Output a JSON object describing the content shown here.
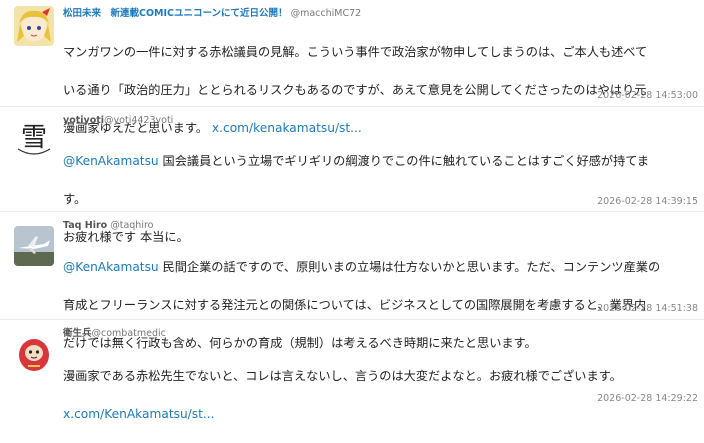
{
  "tweets": [
    {
      "name": "松田未来　新連載COMICユニコーンにて近日公開！",
      "handle": "@macchiMC72",
      "text_line1": "マンガワンの一件に対する赤松議員の見解。こういう事件で政治家が物申してしまうのは、ご本人も述べて",
      "text_line2": "いる通り「政治的圧力」ととられるリスクもあるのですが、あえて意見を公開してくださったのはやはり元",
      "text_line3": "漫画家ゆえだと思います。",
      "link": "x.com/kenakamatsu/st...",
      "timestamp": "2026-02-28 14:53:00"
    },
    {
      "name": "yotiyoti",
      "handle": "@yoti4423yoti",
      "mention": "@KenAkamatsu",
      "text_line1": " 国会議員という立場でギリギリの綱渡りでこの件に触れていることはすごく好感が持てま",
      "text_line2": "す。",
      "text_line3": "お疲れ様です 本当に。",
      "timestamp": "2026-02-28 14:39:15"
    },
    {
      "name": "Taq Hiro",
      "handle": "@taqhiro",
      "mention": "@KenAkamatsu",
      "text_line1": " 民間企業の話ですので、原則いまの立場は仕方ないかと思います。ただ、コンテンツ産業の",
      "text_line2": "育成とフリーランスに対する発注元との関係については、ビジネスとしての国際展開を考慮すると、業界内",
      "text_line3": "だけでは無く行政も含め、何らかの育成（規制）は考えるべき時期に来たと思います。",
      "timestamp": "2026-02-28 14:51:38"
    },
    {
      "name": "衛生兵",
      "handle": "@combatmedic",
      "text_line1": "漫画家である赤松先生でないと、コレは言えないし、言うのは大変だよなと。お疲れ様でございます。",
      "link": "x.com/KenAkamatsu/st...",
      "timestamp": "2026-02-28 14:29:22"
    }
  ],
  "colors": {
    "link": "#1c7bbf",
    "divider": "#e6ecf0",
    "name_highlight": "#1c7bbf"
  },
  "icons": [
    "avatar-anime-girl",
    "avatar-kanji-rain",
    "avatar-airplane",
    "avatar-daruma"
  ]
}
